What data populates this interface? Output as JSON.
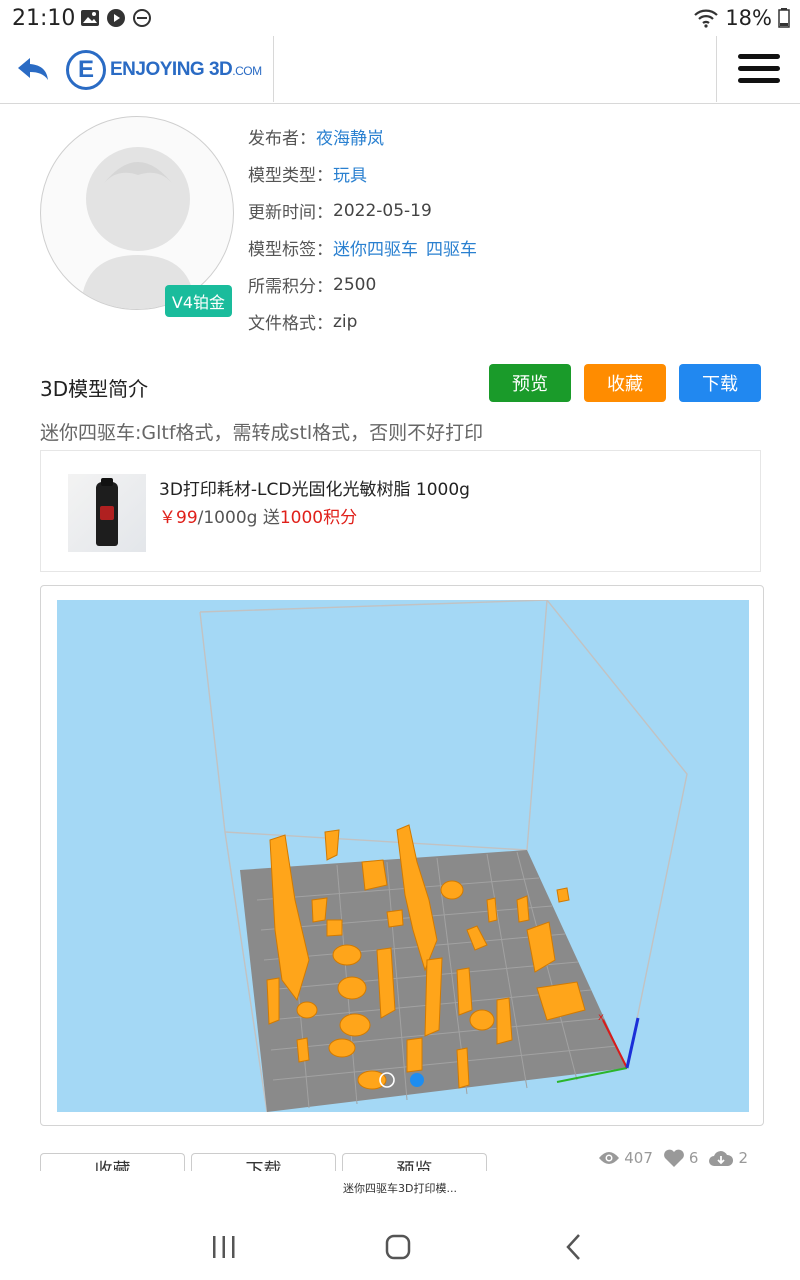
{
  "status_bar": {
    "time": "21:10",
    "battery": "18%"
  },
  "header": {
    "logo_letter": "E",
    "logo_text": "ENJOYING 3D",
    "logo_suffix": ".COM"
  },
  "profile": {
    "badge": "V4铂金",
    "publisher_label": "发布者：",
    "publisher": "夜海静岚",
    "type_label": "模型类型：",
    "type": "玩具",
    "updated_label": "更新时间：",
    "updated": "2022-05-19",
    "tags_label": "模型标签：",
    "tags": [
      "迷你四驱车",
      "四驱车"
    ],
    "points_label": "所需积分：",
    "points": "2500",
    "format_label": "文件格式：",
    "format": "zip"
  },
  "intro": {
    "title": "3D模型简介",
    "preview_btn": "预览",
    "favorite_btn": "收藏",
    "download_btn": "下载",
    "description": "迷你四驱车:Gltf格式，需转成stl格式，否则不好打印"
  },
  "ad": {
    "title": "3D打印耗材-LCD光固化光敏树脂 1000g",
    "price": "￥99",
    "unit": "/1000g 送",
    "bonus": "1000积分"
  },
  "stats": {
    "views": "407",
    "likes": "6",
    "downloads": "2"
  },
  "tabs": [
    "收藏",
    "下载",
    "预览"
  ],
  "footer_title": "迷你四驱车3D打印模..."
}
